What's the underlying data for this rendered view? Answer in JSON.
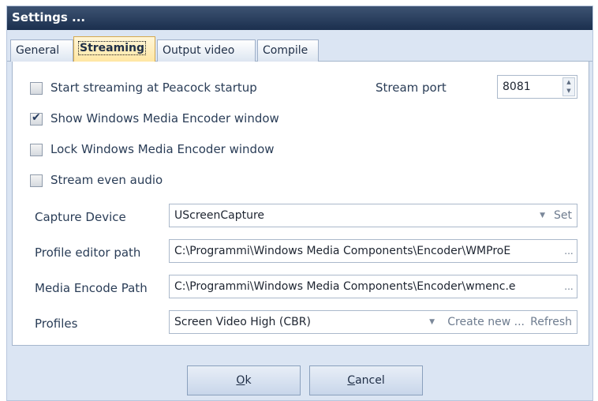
{
  "window": {
    "title": "Settings ..."
  },
  "tabs": [
    {
      "label": "General"
    },
    {
      "label": "Streaming"
    },
    {
      "label": "Output video"
    },
    {
      "label": "Compile"
    }
  ],
  "options": [
    {
      "label": "Start streaming at Peacock startup",
      "checked": false
    },
    {
      "label": "Show Windows Media Encoder window",
      "checked": true
    },
    {
      "label": "Lock Windows Media Encoder window",
      "checked": false
    },
    {
      "label": "Stream even audio",
      "checked": false
    }
  ],
  "stream_port": {
    "label": "Stream port",
    "value": "8081"
  },
  "capture_device": {
    "label": "Capture Device",
    "value": "UScreenCapture",
    "set_label": "Set"
  },
  "profile_editor": {
    "label": "Profile editor path",
    "value": "C:\\Programmi\\Windows Media Components\\Encoder\\WMProE"
  },
  "media_encode": {
    "label": "Media Encode Path",
    "value": "C:\\Programmi\\Windows Media Components\\Encoder\\wmenc.e"
  },
  "profiles": {
    "label": "Profiles",
    "value": "Screen Video High (CBR)",
    "create_label": "Create new ...",
    "refresh_label": "Refresh"
  },
  "buttons": {
    "ok_mnemonic": "O",
    "ok_rest": "k",
    "cancel_mnemonic": "C",
    "cancel_rest": "ancel"
  },
  "icons": {
    "ellipsis": "...",
    "dropdown_arrow": "▼",
    "spin_up": "▲",
    "spin_down": "▼",
    "check": "✔"
  }
}
